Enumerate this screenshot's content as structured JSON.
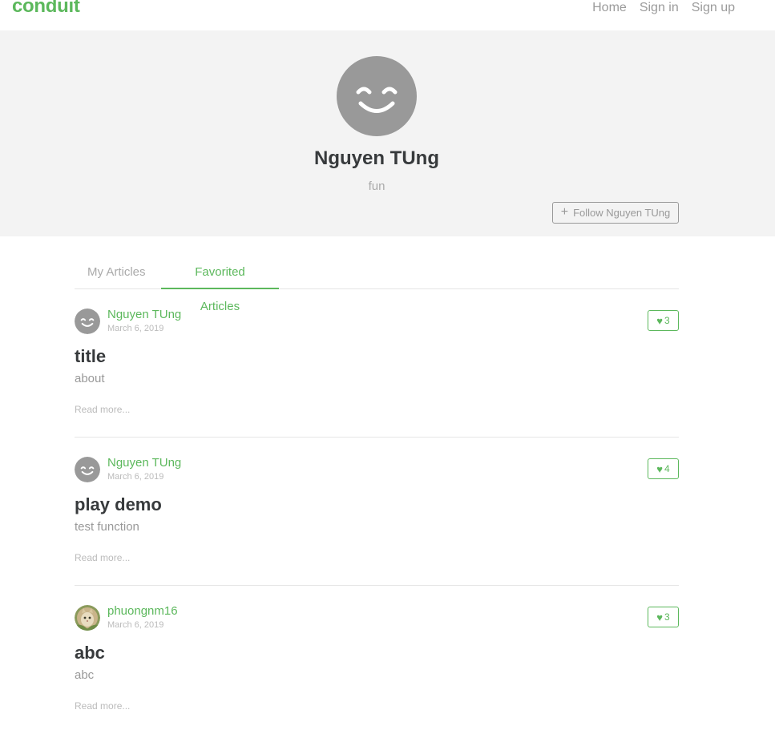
{
  "navbar": {
    "brand": "conduit",
    "links": [
      "Home",
      "Sign in",
      "Sign up"
    ]
  },
  "profile": {
    "name": "Nguyen TUng",
    "bio": "fun",
    "follow_label": "Follow Nguyen TUng",
    "avatar_icon": "smiley-avatar-icon"
  },
  "tabs": {
    "my_articles": "My Articles",
    "favorited_articles": "Favorited Articles",
    "active": "Favorited Articles"
  },
  "articles": [
    {
      "author": "Nguyen TUng",
      "date": "March 6, 2019",
      "likes": "3",
      "title": "title",
      "description": "about",
      "read_more": "Read more..."
    },
    {
      "author": "Nguyen TUng",
      "date": "March 6, 2019",
      "likes": "4",
      "title": "play demo",
      "description": "test function",
      "read_more": "Read more..."
    },
    {
      "author": "phuongnm16",
      "date": "March 6, 2019",
      "likes": "3",
      "title": "abc",
      "description": "abc",
      "read_more": "Read more..."
    }
  ],
  "colors": {
    "accent": "#5cb85c",
    "banner_bg": "#f3f3f3",
    "avatar_gray": "#999999"
  }
}
